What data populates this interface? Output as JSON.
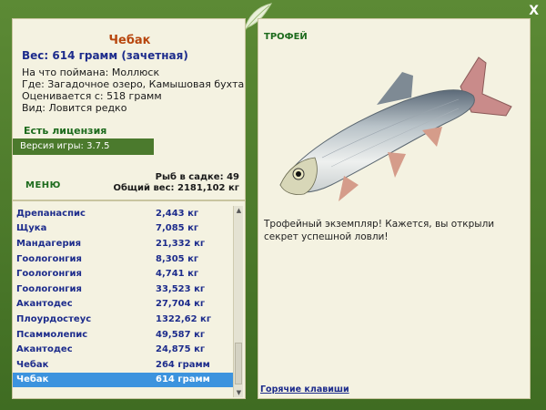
{
  "window": {
    "close_label": "X"
  },
  "fish": {
    "name": "Чебак",
    "weight_line": "Вес: 614 грамм (зачетная)",
    "caught_on": "На что поймана: Моллюск",
    "location": "Где: Загадочное озеро, Камышовая бухта",
    "rated_from": "Оценивается с: 518 грамм",
    "kind": "Вид: Ловится редко"
  },
  "license": "Есть лицензия",
  "version": "Версия игры: 3.7.5",
  "menu_label": "МЕНЮ",
  "stats": {
    "fish_in_keepnet": "Рыб в садке: 49",
    "total_weight": "Общий вес: 2181,102 кг"
  },
  "catch_list": [
    {
      "name": "Дрепанаспис",
      "weight": "2,443 кг"
    },
    {
      "name": "Щука",
      "weight": "7,085 кг"
    },
    {
      "name": "Мандагерия",
      "weight": "21,332 кг"
    },
    {
      "name": "Гоологонгия",
      "weight": "8,305 кг"
    },
    {
      "name": "Гоологонгия",
      "weight": "4,741 кг"
    },
    {
      "name": "Гоологонгия",
      "weight": "33,523 кг"
    },
    {
      "name": "Акантодес",
      "weight": "27,704 кг"
    },
    {
      "name": "Плоурдостеус",
      "weight": "1322,62 кг"
    },
    {
      "name": "Псаммолепис",
      "weight": "49,587 кг"
    },
    {
      "name": "Акантодес",
      "weight": "24,875 кг"
    },
    {
      "name": "Чебак",
      "weight": "264 грамм"
    },
    {
      "name": "Чебак",
      "weight": "614 грамм"
    }
  ],
  "selected_index": 11,
  "trophy": {
    "header": "ТРОФЕЙ",
    "message": "Трофейный экземпляр! Кажется, вы открыли секрет успешной ловли!"
  },
  "hotkeys_label": "Горячие клавиши",
  "colors": {
    "frame_green": "#4a7a2c",
    "panel_bg": "#f4f2e1",
    "fish_name": "#b8470f",
    "list_text": "#1d2c8c",
    "selection": "#3c93de",
    "header_green": "#1d6b1d"
  },
  "icons": {
    "close": "close-icon",
    "leaf": "leaf-icon",
    "fish": "fish-image"
  }
}
